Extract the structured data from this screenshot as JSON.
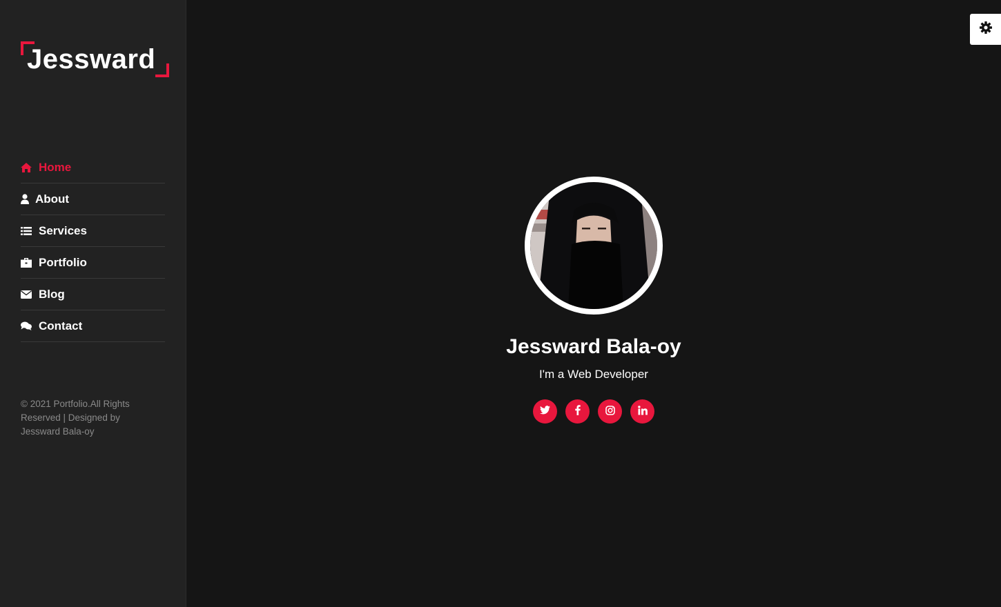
{
  "brand": {
    "logo_text": "Jessward",
    "accent_color": "#e8173d"
  },
  "nav": {
    "items": [
      {
        "label": "Home",
        "icon": "home-icon",
        "active": true
      },
      {
        "label": "About",
        "icon": "user-icon"
      },
      {
        "label": "Services",
        "icon": "list-icon"
      },
      {
        "label": "Portfolio",
        "icon": "briefcase-icon"
      },
      {
        "label": "Blog",
        "icon": "envelope-icon"
      },
      {
        "label": "Contact",
        "icon": "comments-icon"
      }
    ]
  },
  "footer": {
    "copyright": "© 2021 Portfolio.All Rights Reserved | Designed by Jessward Bala-oy"
  },
  "hero": {
    "name": "Jessward Bala-oy",
    "role": "I'm a Web Developer",
    "socials": [
      {
        "name": "twitter-icon",
        "glyph": "t"
      },
      {
        "name": "facebook-icon",
        "glyph": "f"
      },
      {
        "name": "instagram-icon",
        "glyph": ""
      },
      {
        "name": "linkedin-icon",
        "glyph": "in"
      }
    ]
  },
  "settings": {
    "icon": "gear-icon"
  }
}
